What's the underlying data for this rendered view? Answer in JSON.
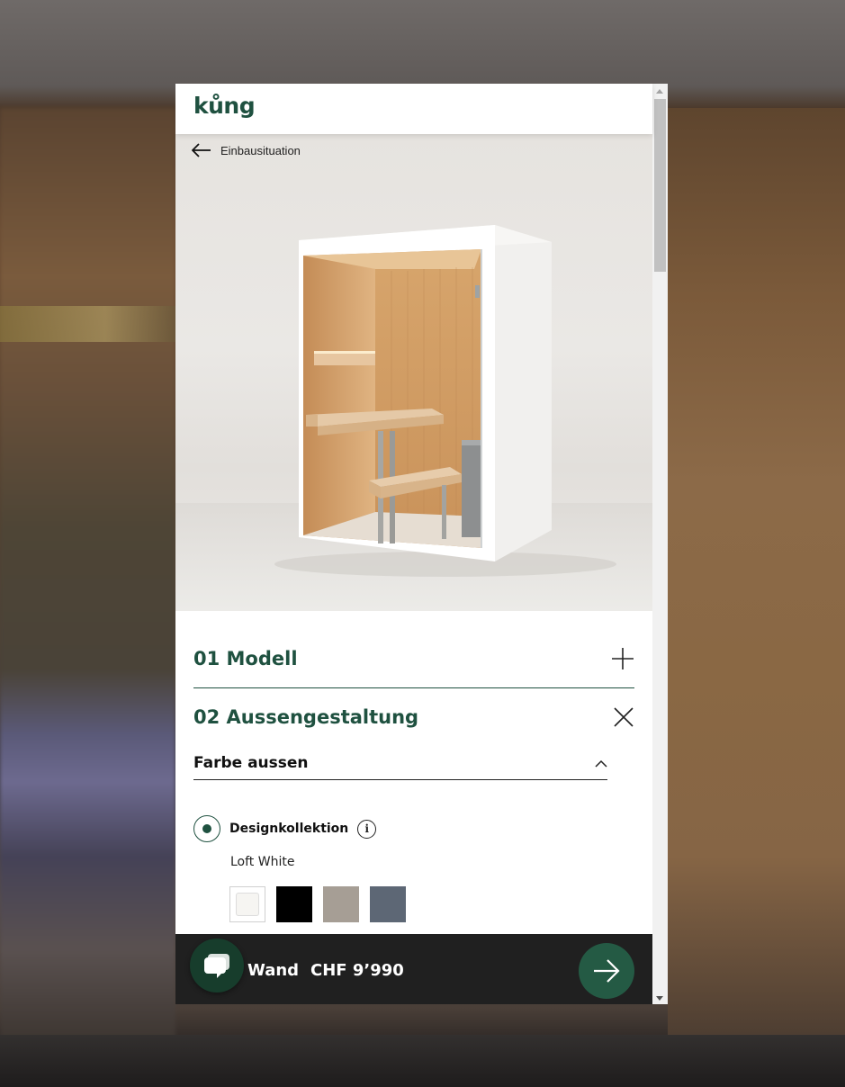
{
  "brand": {
    "logo_text": "kůng",
    "color": "#1f5140"
  },
  "hero": {
    "back_label": "Einbausituation"
  },
  "sections": [
    {
      "title": "01 Modell",
      "icon": "plus-icon",
      "expanded": false
    },
    {
      "title": "02 Aussengestaltung",
      "icon": "close-icon",
      "expanded": true
    }
  ],
  "subsection": {
    "title": "Farbe aussen",
    "icon": "chevron-up-icon"
  },
  "option": {
    "label": "Designkollektion",
    "selected": true,
    "info_icon": "info-icon"
  },
  "selected_color": "Loft White",
  "swatches": [
    {
      "name": "Loft White",
      "color": "#f6f5f2",
      "selected": true
    },
    {
      "name": "Black",
      "color": "#000000",
      "selected": false
    },
    {
      "name": "Taupe",
      "color": "#a69e95",
      "selected": false
    },
    {
      "name": "Slate",
      "color": "#5d6775",
      "selected": false
    }
  ],
  "bottom_bar": {
    "label": "Wand",
    "price": "CHF 9’990",
    "next_icon": "arrow-right-icon",
    "chat_icon": "chat-icon"
  }
}
